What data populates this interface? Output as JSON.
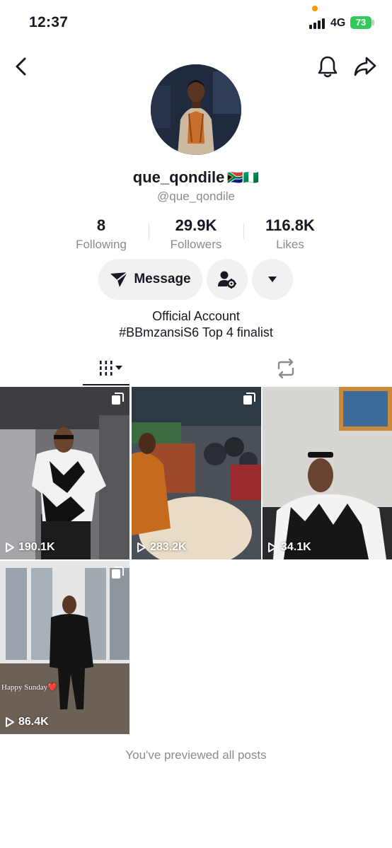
{
  "status_bar": {
    "time": "12:37",
    "network": "4G",
    "battery": "73"
  },
  "profile": {
    "username": "que_qondile",
    "flags": "🇿🇦🇳🇬",
    "handle": "@que_qondile",
    "stats": [
      {
        "value": "8",
        "label": "Following"
      },
      {
        "value": "29.9K",
        "label": "Followers"
      },
      {
        "value": "116.8K",
        "label": "Likes"
      }
    ],
    "message_label": "Message",
    "bio_lines": [
      "Official Account",
      "#BBmzansiS6 Top 4 finalist"
    ]
  },
  "posts": [
    {
      "views": "190.1K"
    },
    {
      "views": "283.2K"
    },
    {
      "views": "34.1K"
    },
    {
      "views": "86.4K",
      "caption": "Happy Sunday❤️"
    }
  ],
  "footer_text": "You've previewed all posts",
  "colors": {
    "text": "#161823",
    "secondary": "#8a8b91",
    "pill": "#f1f1f2",
    "battery": "#34c759"
  }
}
